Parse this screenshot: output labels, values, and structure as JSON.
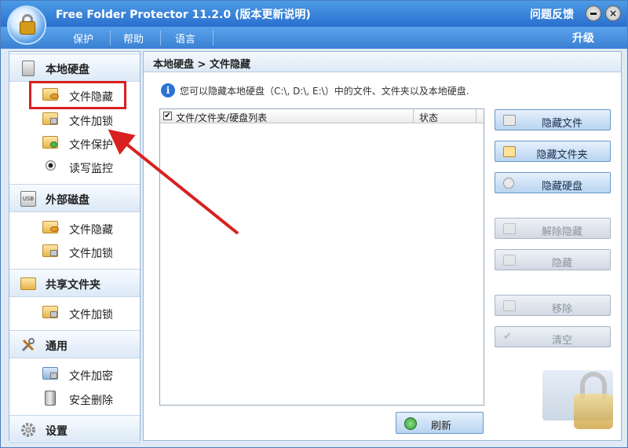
{
  "window": {
    "title": "Free Folder Protector 11.2.0 (版本更新说明)",
    "feedback": "问题反馈",
    "minimize_icon": "minimize-icon",
    "close_icon": "close-icon",
    "close_glyph": "×"
  },
  "menubar": {
    "items": [
      "保护",
      "帮助",
      "语言"
    ],
    "upgrade": "升级"
  },
  "sidebar": {
    "sections": [
      {
        "label": "本地硬盘",
        "icon": "hard-disk-icon",
        "items": [
          "文件隐藏",
          "文件加锁",
          "文件保护",
          "读写监控"
        ]
      },
      {
        "label": "外部磁盘",
        "icon": "usb-drive-icon",
        "items": [
          "文件隐藏",
          "文件加锁"
        ]
      },
      {
        "label": "共享文件夹",
        "icon": "shared-folder-icon",
        "items": [
          "文件加锁"
        ]
      },
      {
        "label": "通用",
        "icon": "tools-icon",
        "items": [
          "文件加密",
          "安全删除"
        ]
      },
      {
        "label": "设置",
        "icon": "gear-icon",
        "items": []
      }
    ],
    "selected_item": "文件隐藏",
    "usb_badge": "USB"
  },
  "main": {
    "breadcrumb": "本地硬盘 > 文件隐藏",
    "info": "您可以隐藏本地硬盘（C:\\, D:\\, E:\\）中的文件、文件夹以及本地硬盘.",
    "info_icon_glyph": "i",
    "list": {
      "checkbox": "✔",
      "col_name": "文件/文件夹/硬盘列表",
      "col_status": "状态",
      "rows": []
    },
    "refresh": "刷新"
  },
  "actions": {
    "hide_file": "隐藏文件",
    "hide_folder": "隐藏文件夹",
    "hide_disk": "隐藏硬盘",
    "unhide": "解除隐藏",
    "hide": "隐藏",
    "remove": "移除",
    "clear": "清空"
  },
  "colors": {
    "titlebar": "#2a6fcf",
    "highlight": "#d82020",
    "button": "#b9d4f1"
  }
}
